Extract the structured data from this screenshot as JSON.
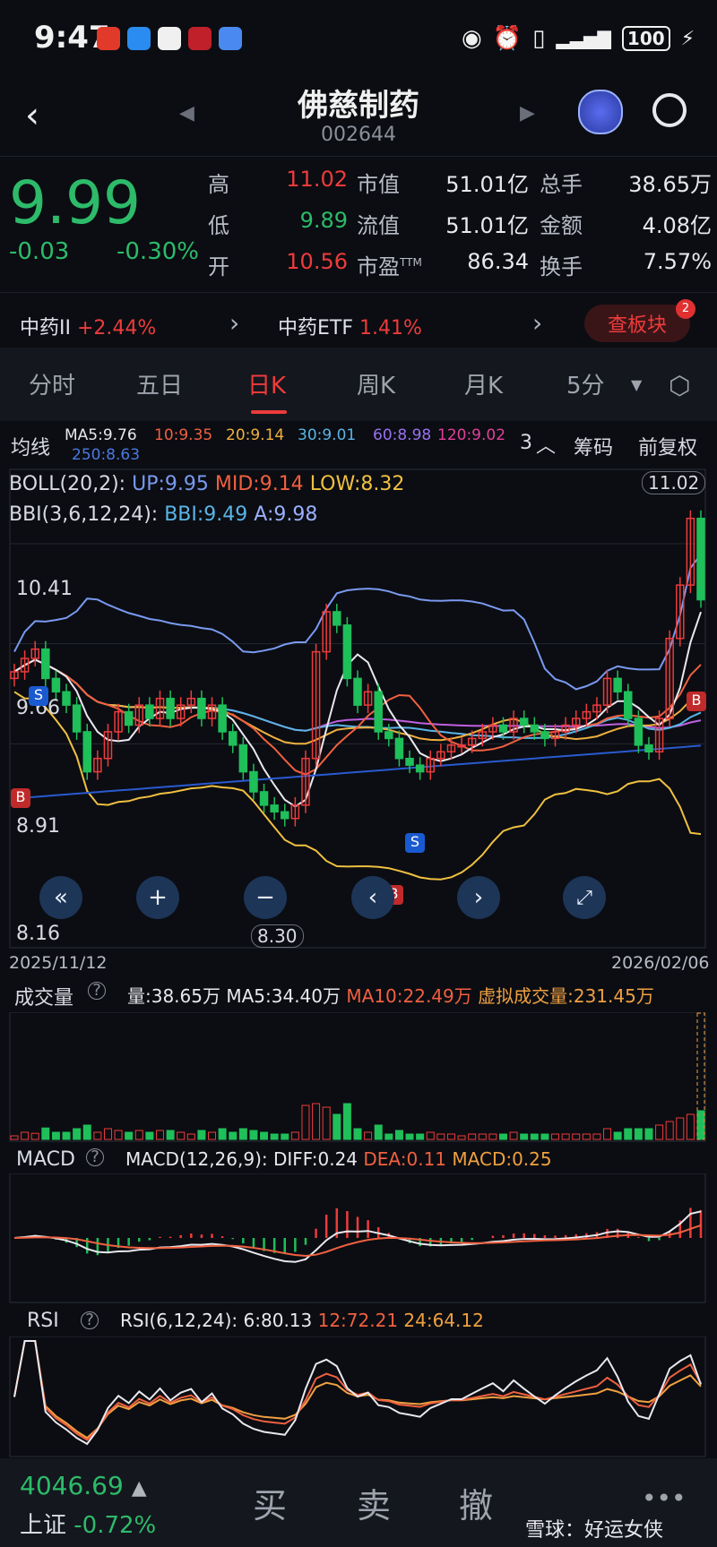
{
  "status": {
    "time": "9:47",
    "battery": "100"
  },
  "header": {
    "title": "佛慈制药",
    "code": "002644"
  },
  "quote": {
    "price": "9.99",
    "change": "-0.03",
    "change_pct": "-0.30%",
    "rows": [
      {
        "l1": "高",
        "v1": "11.02",
        "l2": "市值",
        "v2": "51.01亿",
        "l3": "总手",
        "v3": "38.65万"
      },
      {
        "l1": "低",
        "v1": "9.89",
        "l2": "流值",
        "v2": "51.01亿",
        "l3": "金额",
        "v3": "4.08亿"
      },
      {
        "l1": "开",
        "v1": "10.56",
        "l2": "市盈",
        "l2sup": "TTM",
        "v2": "86.34",
        "l3": "换手",
        "v3": "7.57%"
      }
    ]
  },
  "sector": {
    "name1": "中药II",
    "pct1": "+2.44%",
    "name2": "中药ETF",
    "pct2": "1.41%",
    "button": "查板块",
    "badge": "2"
  },
  "tabs": [
    "分时",
    "五日",
    "日K",
    "周K",
    "月K",
    "5分"
  ],
  "ma_bar": {
    "label": "均线",
    "items": [
      {
        "t": "MA5:9.76",
        "c": "#e8e8ee"
      },
      {
        "t": "10:9.35",
        "c": "#f06040"
      },
      {
        "t": "20:9.14",
        "c": "#f0b040"
      },
      {
        "t": "30:9.01",
        "c": "#5ab4e6"
      },
      {
        "t": "60:8.98",
        "c": "#c060e0"
      },
      {
        "t": "120:9.02",
        "c": "#e0409a"
      }
    ],
    "ma250": "250:8.63",
    "count": "3",
    "chip": "筹码",
    "adjust": "前复权"
  },
  "kline": {
    "boll": {
      "prefix": "BOLL(20,2):",
      "up": "UP:9.95",
      "mid": "MID:9.14",
      "low": "LOW:8.32"
    },
    "bbi": {
      "prefix": "BBI(3,6,12,24):",
      "bbi": "BBI:9.49",
      "a": "A:9.98"
    },
    "ylabels": [
      "10.41",
      "9.66",
      "8.91",
      "8.16"
    ],
    "high_label": "11.02",
    "low_label": "8.30",
    "date_start": "2025/11/12",
    "date_end": "2026/02/06",
    "sell_mark": "S",
    "buy_mark": "B"
  },
  "volume": {
    "label": "成交量",
    "info": "量:38.65万 MA5:34.40万",
    "ma10": "MA10:22.49万",
    "virtual": "虚拟成交量:231.45万"
  },
  "macd": {
    "label": "MACD",
    "params": "MACD(12,26,9):",
    "diff": "DIFF:0.24",
    "dea": "DEA:0.11",
    "macd": "MACD:0.25"
  },
  "rsi": {
    "label": "RSI",
    "params": "RSI(6,12,24):",
    "r6": "6:80.13",
    "r12": "12:72.21",
    "r24": "24:64.12"
  },
  "index": {
    "value": "4046.69",
    "name": "上证",
    "pct": "-0.72%"
  },
  "actions": {
    "buy": "买",
    "sell": "卖",
    "cancel": "撤"
  },
  "watermark": "雪球：好运女侠",
  "chart_data": {
    "type": "candlestick",
    "price_axis_labels": [
      10.41,
      9.66,
      8.91,
      8.16
    ],
    "closes": [
      9.45,
      9.55,
      9.62,
      9.4,
      9.3,
      9.2,
      9.0,
      8.7,
      8.8,
      9.0,
      9.15,
      9.05,
      9.2,
      9.1,
      9.25,
      9.1,
      9.2,
      9.25,
      9.1,
      9.2,
      9.0,
      8.9,
      8.7,
      8.55,
      8.45,
      8.4,
      8.35,
      8.45,
      8.8,
      9.6,
      9.9,
      9.8,
      9.4,
      9.2,
      9.3,
      9.0,
      8.95,
      8.8,
      8.75,
      8.7,
      8.8,
      8.85,
      8.9,
      8.9,
      8.95,
      9.0,
      9.05,
      9.0,
      9.1,
      9.05,
      9.0,
      8.95,
      9.0,
      9.05,
      9.1,
      9.15,
      9.2,
      9.4,
      9.3,
      9.1,
      8.9,
      8.85,
      9.1,
      9.7,
      10.1,
      10.6,
      9.99
    ],
    "high": 11.02,
    "low": 8.3
  }
}
